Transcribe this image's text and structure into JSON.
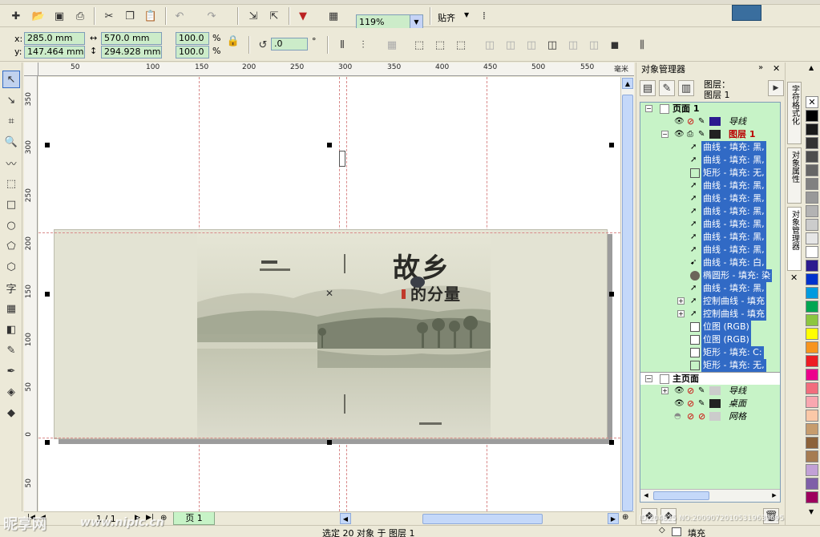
{
  "toolbar": {
    "zoom": "119%",
    "snap_label": "贴齐"
  },
  "property_bar": {
    "x_label": "x:",
    "y_label": "y:",
    "x_value": "285.0 mm",
    "y_value": "147.464 mm",
    "w_value": "570.0 mm",
    "h_value": "294.928 mm",
    "scale_w": "100.0",
    "scale_h": "100.0",
    "percent": "%",
    "rotation": ".0",
    "degree": "°"
  },
  "hruler": {
    "ticks": [
      "50",
      "100",
      "150",
      "200",
      "250",
      "300",
      "350",
      "400",
      "450",
      "500",
      "550"
    ],
    "unit": "毫米"
  },
  "vruler": {
    "ticks": [
      "350",
      "300",
      "250",
      "200",
      "150",
      "100",
      "50",
      "0",
      "50"
    ]
  },
  "artwork": {
    "title_line1": "故乡",
    "title_line2": "的分量"
  },
  "page_nav": {
    "counter": "1 / 1",
    "page_tab": "页 1"
  },
  "docker": {
    "title": "对象管理器",
    "layer_header_label": "图层：",
    "layer_header_value": "图层 1",
    "page1_label": "页面 1",
    "master_label": "主页面",
    "layers": {
      "guides": "导线",
      "layer1": "图层 1",
      "desktop": "桌面",
      "grid": "网格"
    },
    "objects": [
      "曲线 - 填充: 黑,",
      "曲线 - 填充: 黑,",
      "矩形 - 填充: 无,",
      "曲线 - 填充: 黑,",
      "曲线 - 填充: 黑,",
      "曲线 - 填充: 黑,",
      "曲线 - 填充: 黑,",
      "曲线 - 填充: 黑,",
      "曲线 - 填充: 黑,",
      "曲线 - 填充: 白,",
      "椭圆形 - 填充: 染",
      "曲线 - 填充: 黑,",
      "控制曲线 - 填充",
      "控制曲线 - 填充",
      "位图 (RGB)",
      "位图 (RGB)",
      "矩形 - 填充: C:",
      "矩形 - 填充: 无,"
    ]
  },
  "side_tabs": [
    "字符格式化",
    "对象属性",
    "对象管理器"
  ],
  "palette": [
    "#ffffff",
    "#000000",
    "#1a1a1a",
    "#333333",
    "#4d4d4d",
    "#666666",
    "#808080",
    "#999999",
    "#b3b3b3",
    "#cccccc",
    "#e6e6e6",
    "#ffffff",
    "#2b1b8f",
    "#0033cc",
    "#009bdf",
    "#00a651",
    "#8cc63f",
    "#ffff00",
    "#f7941d",
    "#ed1c24",
    "#ec008c",
    "#f26d7d",
    "#f9a7b0",
    "#fbc8a7",
    "#c69c6d",
    "#8c6239",
    "#a67c52",
    "#c2a1d6",
    "#7f5fa8",
    "#9e005d"
  ],
  "status": {
    "selection": "选定 20 对象 于 图层 1",
    "fill": "填充"
  },
  "watermark": {
    "brand": "昵享网",
    "url": "www.nipic.cn",
    "id_info": "ID:204825 NO:20090720105319639695"
  }
}
